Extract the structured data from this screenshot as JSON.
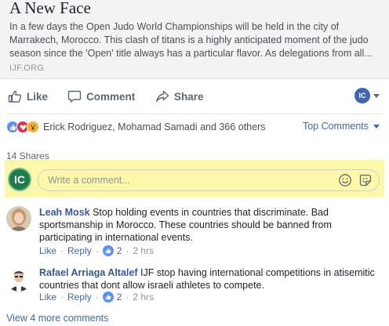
{
  "link_preview": {
    "title": "A New Face",
    "description_lines": [
      "In a few days the Open Judo World Championships will be held in the city of",
      "Marrakech, Morocco. This clash of titans is a highly anticipated moment of the judo",
      "season since the 'Open' title always has a particular flavor. As delegations from all..."
    ],
    "domain": "IJF.ORG"
  },
  "actions": {
    "like": "Like",
    "comment": "Comment",
    "share": "Share",
    "page_initials": "IC"
  },
  "reactions": {
    "icons": [
      "like-icon",
      "love-icon",
      "wow-icon"
    ],
    "summary": "Erick Rodriguez, Mohamad Samadi and 366 others",
    "sort": "Top Comments"
  },
  "shares": "14 Shares",
  "composer": {
    "avatar_initials": "IC",
    "placeholder": "Write a comment..."
  },
  "comments": [
    {
      "author": "Leah Mosk",
      "text": "Stop holding events in countries that discriminate. Bad sportsmanship in Morocco. These countries should be banned from participating in international events.",
      "like": "Like",
      "reply": "Reply",
      "likes": "2",
      "time": "2 hrs"
    },
    {
      "author": "Rafael Arriaga Altalef",
      "text": "IJF stop having international competitions in atisemitic countries that dont allow israeli athletes to compete.",
      "like": "Like",
      "reply": "Reply",
      "likes": "2",
      "time": "2 hrs"
    }
  ],
  "view_more": "View 4 more comments",
  "colors": {
    "brand_blue": "#4267b2",
    "link_blue": "#365899",
    "composer_highlight": "#fcf8a9"
  }
}
